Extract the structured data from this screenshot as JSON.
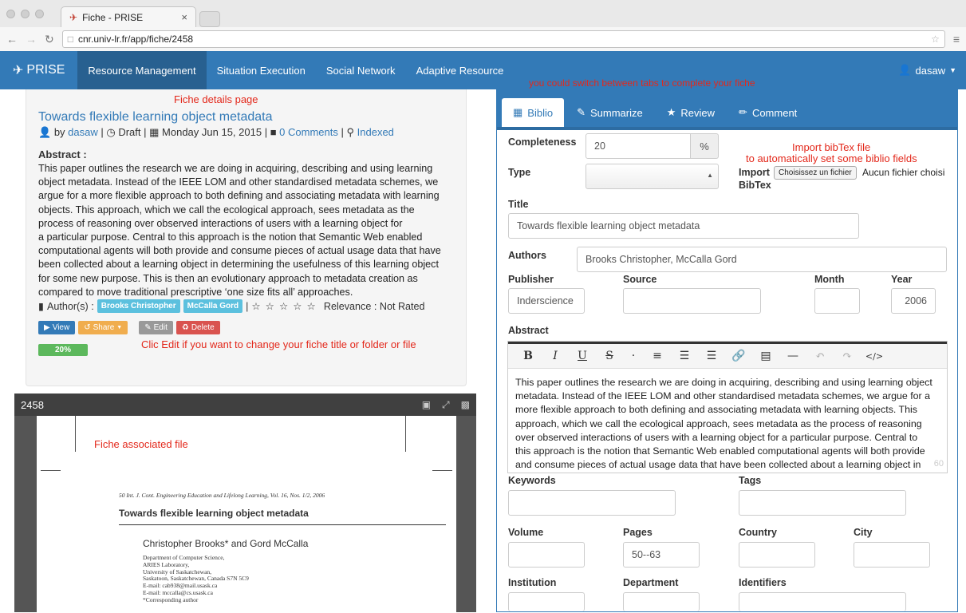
{
  "browser": {
    "tab_title": "Fiche - PRISE",
    "tab_close": "×",
    "url": "cnr.univ-lr.fr/app/fiche/2458"
  },
  "navbar": {
    "brand": "PRISE",
    "items": [
      "Resource Management",
      "Situation Execution",
      "Social Network",
      "Adaptive Resource"
    ],
    "active_index": 0,
    "user": "dasaw"
  },
  "annotations": {
    "fiche_details": "Fiche details page",
    "switch_tabs": "you could switch between tabs to complete your fiche",
    "import_bibtex_1": "Import bibTex file",
    "import_bibtex_2": "to automatically set some biblio fields",
    "clic_edit": "Clic Edit if you want to change your fiche title or folder or file",
    "associated_file": "Fiche associated file"
  },
  "fiche": {
    "title": "Towards flexible learning object metadata",
    "by": "by",
    "author": "dasaw",
    "status": "Draft",
    "date": "Monday Jun 15, 2015",
    "comments": "0 Comments",
    "indexed": "Indexed",
    "abstract_label": "Abstract :",
    "abstract_lines": [
      "This paper outlines the research we are doing in acquiring, describing and using learning",
      "object metadata. Instead of the IEEE LOM and other standardised metadata schemes, we",
      "argue for a more flexible approach to both defining and associating metadata with learning",
      "objects. This approach, which we call the ecological approach, sees metadata as the",
      "process of reasoning over observed interactions of users with a learning object for",
      "a particular purpose. Central to this approach is the notion that Semantic Web enabled",
      "computational agents will both provide and consume pieces of actual usage data that have",
      "been collected about a learning object in determining the usefulness of this learning object",
      "for some new purpose. This is then an evolutionary approach to metadata creation as",
      "compared to move traditional prescriptive ‘one size fits all’ approaches."
    ],
    "authors_label": "Author(s) :",
    "author_tags": [
      "Brooks Christopher",
      "McCalla Gord"
    ],
    "rating_stars": 0,
    "relevance": "Relevance : Not Rated",
    "buttons": {
      "view": "View",
      "share": "Share",
      "edit": "Edit",
      "delete": "Delete"
    },
    "progress": "20%",
    "progress_value": 20
  },
  "viewer": {
    "doc_id": "2458",
    "journal_line": "50    Int. J. Cont. Engineering Education and Lifelong Learning, Vol. 16, Nos. 1/2, 2006",
    "paper_title": "Towards flexible learning object metadata",
    "paper_authors": "Christopher Brooks* and Gord McCalla",
    "affiliation": [
      "Department of Computer Science,",
      "ARIES Laboratory,",
      "University of Saskatchewan,",
      "Saskatoon, Saskatchewan, Canada S7N 5C9",
      "E-mail: cab938@mail.usask.ca",
      "E-mail: mccalla@cs.usask.ca",
      "*Corresponding author"
    ]
  },
  "form": {
    "tabs": [
      "Biblio",
      "Summarize",
      "Review",
      "Comment"
    ],
    "active_tab": 0,
    "completeness_label": "Completeness",
    "completeness_value": "20",
    "completeness_unit": "%",
    "type_label": "Type",
    "type_value": "",
    "import_label_1": "Import",
    "import_label_2": "BibTex",
    "file_button": "Choisissez un fichier",
    "file_none": "Aucun fichier choisi",
    "title_label": "Title",
    "title_value": "Towards flexible learning object metadata",
    "authors_label": "Authors",
    "authors_value": "Brooks Christopher, McCalla Gord",
    "publisher_label": "Publisher",
    "publisher_value": "Inderscience",
    "source_label": "Source",
    "source_value": "",
    "month_label": "Month",
    "month_value": "",
    "year_label": "Year",
    "year_value": "2006",
    "abstract_label": "Abstract",
    "abstract_lines": [
      "This paper outlines the research we are doing in acquiring, describing and using learning object",
      "metadata. Instead of the IEEE LOM and other standardised metadata schemes, we argue for a",
      "more flexible approach to both defining and associating metadata with learning objects. This",
      "approach, which we call the ecological approach, sees metadata as the process of reasoning",
      "over observed interactions of users with a learning object for a particular purpose. Central to",
      "this approach is the notion that Semantic Web enabled computational agents will both provide",
      "and consume pieces of actual usage data that have been collected about a learning object in"
    ],
    "char_count": "60",
    "keywords_label": "Keywords",
    "tags_label": "Tags",
    "volume_label": "Volume",
    "pages_label": "Pages",
    "pages_value": "50--63",
    "country_label": "Country",
    "city_label": "City",
    "institution_label": "Institution",
    "department_label": "Department",
    "identifiers_label": "Identifiers"
  }
}
